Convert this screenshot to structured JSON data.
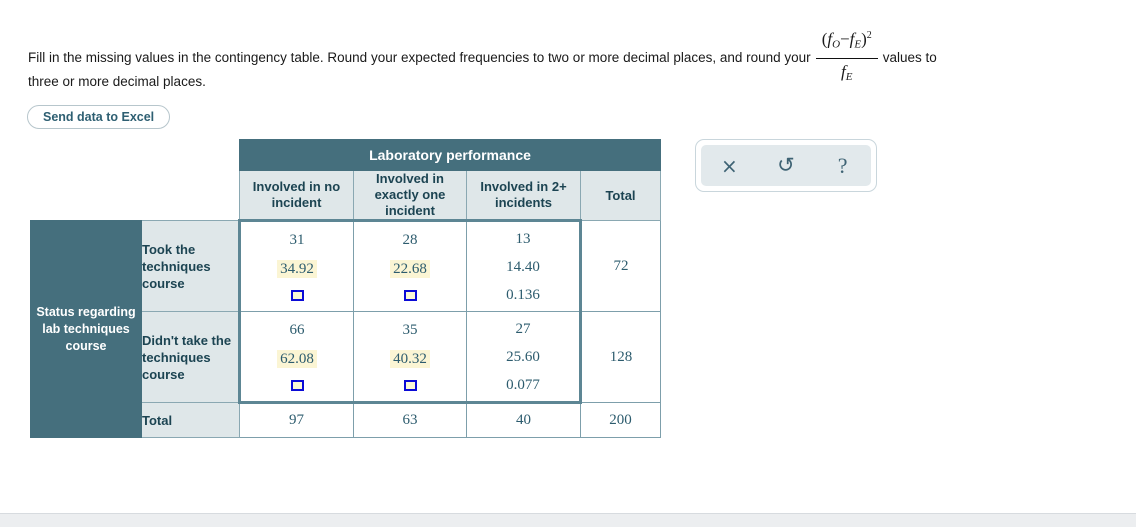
{
  "instructions": {
    "part1": "Fill in the missing values in the contingency table. Round your expected frequencies to two or more decimal places, and round your",
    "formula_numerator_base": "(f",
    "formula": {
      "num_open": "(",
      "num_fo": "f",
      "num_fo_sub": "O",
      "num_minus": "−",
      "num_fe": "f",
      "num_fe_sub": "E",
      "num_close": ")",
      "num_exp": "2",
      "den_fe": "f",
      "den_fe_sub": "E"
    },
    "part2": "values to",
    "part3": "three or more decimal places."
  },
  "excel_button": {
    "label": "Send data to Excel"
  },
  "toolbar": {
    "close_icon": "×",
    "undo_icon": "↺",
    "help_icon": "?"
  },
  "table": {
    "group_header": "Laboratory performance",
    "row_axis_label": "Status regarding lab techniques course",
    "column_headers": [
      "Involved in no incident",
      "Involved in exactly one incident",
      "Involved in 2+ incidents",
      "Total"
    ],
    "rows": [
      {
        "label": "Took the techniques course",
        "cells": [
          {
            "observed": "31",
            "expected": "34.92",
            "expected_highlighted": true,
            "contribution": "",
            "contribution_is_input": true
          },
          {
            "observed": "28",
            "expected": "22.68",
            "expected_highlighted": true,
            "contribution": "",
            "contribution_is_input": true
          },
          {
            "observed": "13",
            "expected": "14.40",
            "expected_highlighted": false,
            "contribution": "0.136",
            "contribution_is_input": false
          }
        ],
        "total": "72"
      },
      {
        "label": "Didn't take the techniques course",
        "cells": [
          {
            "observed": "66",
            "expected": "62.08",
            "expected_highlighted": true,
            "contribution": "",
            "contribution_is_input": true
          },
          {
            "observed": "35",
            "expected": "40.32",
            "expected_highlighted": true,
            "contribution": "",
            "contribution_is_input": true
          },
          {
            "observed": "27",
            "expected": "25.60",
            "expected_highlighted": false,
            "contribution": "0.077",
            "contribution_is_input": false
          }
        ],
        "total": "128"
      }
    ],
    "total_row": {
      "label": "Total",
      "values": [
        "97",
        "63",
        "40"
      ],
      "grand_total": "200"
    }
  },
  "colors": {
    "teal_header": "#456f7d",
    "light_header": "#dfe7e9",
    "text_navy": "#1c4452",
    "data_text": "#2d5c6e",
    "highlight_yellow": "#fbf5d4",
    "input_border_blue": "#0b0bd6",
    "input_fill": "#fbf8d6",
    "button_text": "#2e5f72"
  }
}
